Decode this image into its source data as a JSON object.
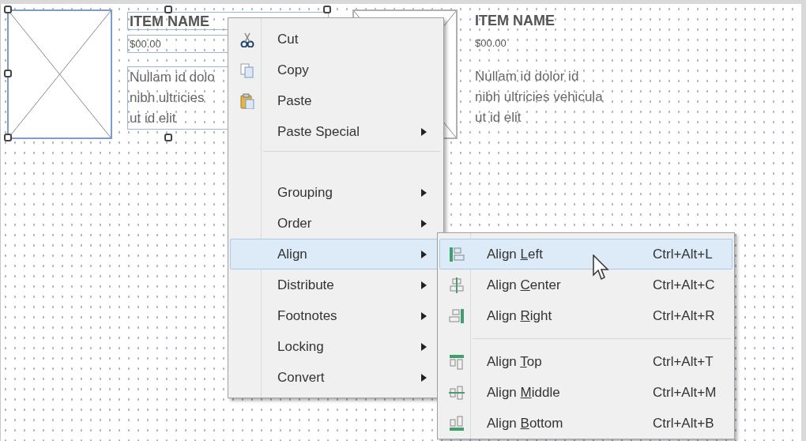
{
  "canvas": {
    "cards": [
      {
        "selected": true,
        "name": "ITEM NAME",
        "price": "$00.00",
        "description_lines": [
          "Nullam id dolo",
          "nibh ultricies",
          "ut id elit"
        ]
      },
      {
        "selected": false,
        "name": "ITEM NAME",
        "price": "$00.00",
        "description_lines": [
          "Nullam id dolor id",
          "nibh ultricies vehicula",
          "ut id elit"
        ]
      }
    ]
  },
  "context_menu": {
    "items": [
      {
        "kind": "item",
        "label": "Cut",
        "submenu": false,
        "selected": false
      },
      {
        "kind": "item",
        "label": "Copy",
        "submenu": false,
        "selected": false
      },
      {
        "kind": "item",
        "label": "Paste",
        "submenu": false,
        "selected": false
      },
      {
        "kind": "item",
        "label": "Paste Special",
        "submenu": true,
        "selected": false
      },
      {
        "kind": "separator"
      },
      {
        "kind": "item",
        "label": "Grouping",
        "submenu": true,
        "selected": false
      },
      {
        "kind": "item",
        "label": "Order",
        "submenu": true,
        "selected": false
      },
      {
        "kind": "item",
        "label": "Align",
        "submenu": true,
        "selected": true
      },
      {
        "kind": "item",
        "label": "Distribute",
        "submenu": true,
        "selected": false
      },
      {
        "kind": "item",
        "label": "Footnotes",
        "submenu": true,
        "selected": false
      },
      {
        "kind": "item",
        "label": "Locking",
        "submenu": true,
        "selected": false
      },
      {
        "kind": "item",
        "label": "Convert",
        "submenu": true,
        "selected": false
      }
    ]
  },
  "align_submenu": {
    "items": [
      {
        "kind": "item",
        "label": {
          "before": "Align ",
          "key": "L",
          "after": "eft"
        },
        "shortcut": "Ctrl+Alt+L",
        "selected": true
      },
      {
        "kind": "item",
        "label": {
          "before": "Align ",
          "key": "C",
          "after": "enter"
        },
        "shortcut": "Ctrl+Alt+C",
        "selected": false
      },
      {
        "kind": "item",
        "label": {
          "before": "Align ",
          "key": "R",
          "after": "ight"
        },
        "shortcut": "Ctrl+Alt+R",
        "selected": false
      },
      {
        "kind": "separator"
      },
      {
        "kind": "item",
        "label": {
          "before": "Align ",
          "key": "T",
          "after": "op"
        },
        "shortcut": "Ctrl+Alt+T",
        "selected": false
      },
      {
        "kind": "item",
        "label": {
          "before": "Align ",
          "key": "M",
          "after": "iddle"
        },
        "shortcut": "Ctrl+Alt+M",
        "selected": false
      },
      {
        "kind": "item",
        "label": {
          "before": "Align ",
          "key": "B",
          "after": "ottom"
        },
        "shortcut": "Ctrl+Alt+B",
        "selected": false
      }
    ]
  }
}
